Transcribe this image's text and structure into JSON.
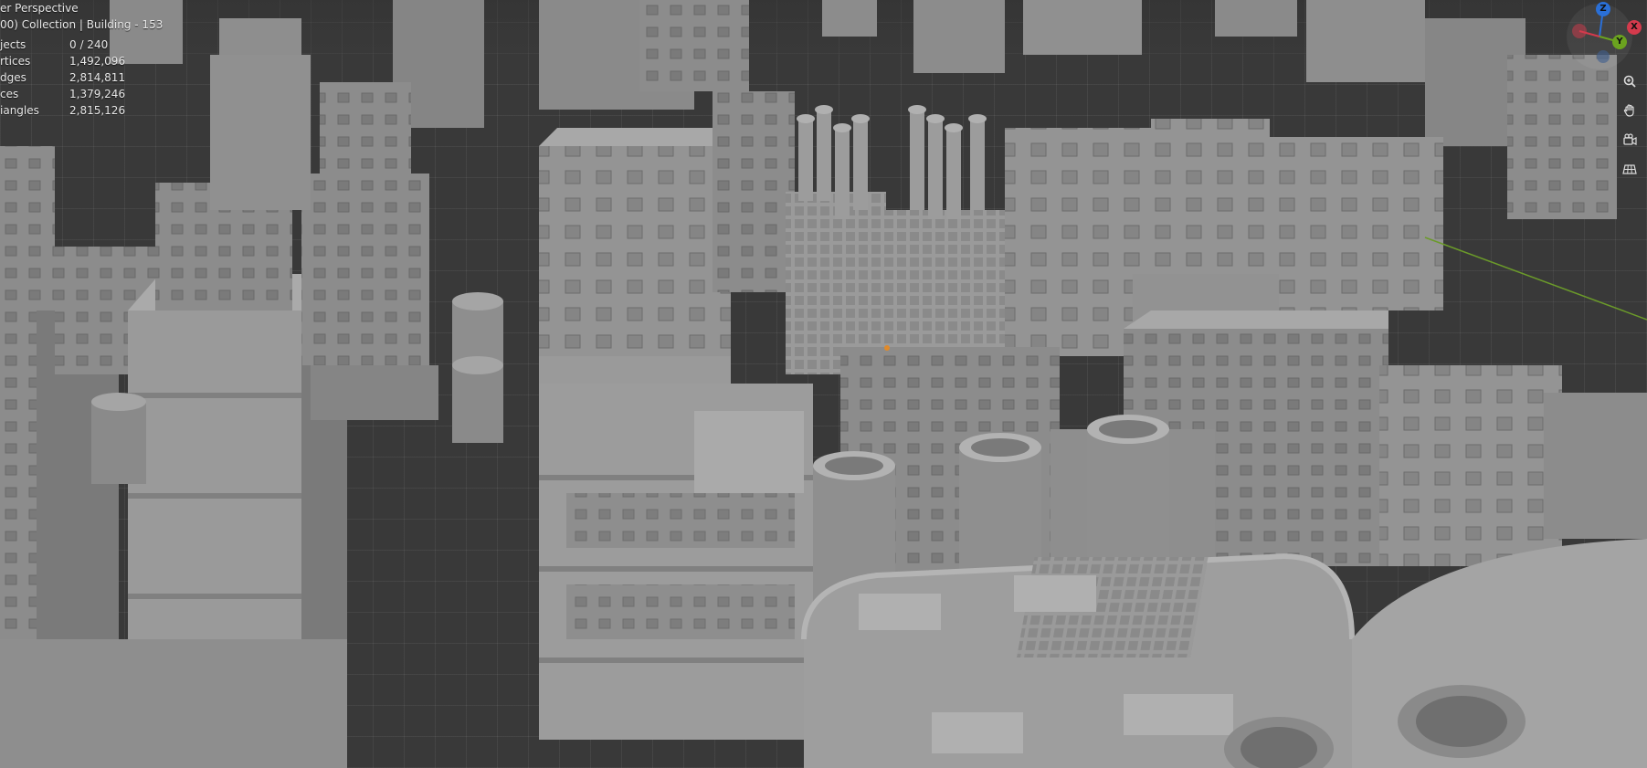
{
  "viewport": {
    "title_partial": "er Perspective",
    "collection_partial": "00) Collection | Building - 153",
    "stats": [
      {
        "label": "jects",
        "value": "0 / 240"
      },
      {
        "label": "rtices",
        "value": "1,492,096"
      },
      {
        "label": "dges",
        "value": "2,814,811"
      },
      {
        "label": "ces",
        "value": "1,379,246"
      },
      {
        "label": "iangles",
        "value": "2,815,126"
      }
    ]
  },
  "gizmo": {
    "axes": {
      "z": {
        "label": "Z",
        "color": "#2a6fd6"
      },
      "y": {
        "label": "Y",
        "color": "#6ba31f"
      },
      "x": {
        "label": "X",
        "color": "#d43a4c"
      }
    },
    "tools": [
      {
        "name": "zoom-icon"
      },
      {
        "name": "pan-hand-icon"
      },
      {
        "name": "camera-icon"
      },
      {
        "name": "grid-icon"
      }
    ]
  },
  "scene": {
    "grid_color": "#404040",
    "building_color": "#8d8d8d",
    "building_light": "#a3a3a3",
    "building_dark": "#6d6d6d"
  }
}
